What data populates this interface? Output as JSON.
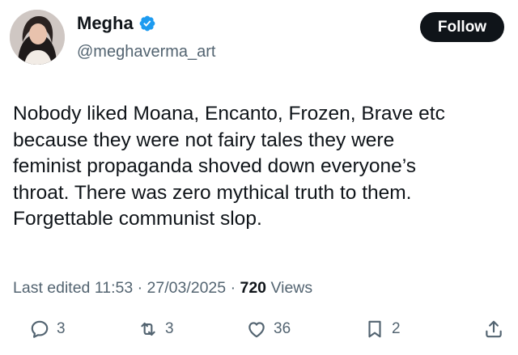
{
  "author": {
    "display_name": "Megha",
    "handle": "@meghaverma_art",
    "verified": true,
    "verified_color": "#1d9bf0",
    "avatar_icon": "profile-photo"
  },
  "follow_button": {
    "label": "Follow"
  },
  "tweet": {
    "lines": [
      "Nobody liked Moana, Encanto, Frozen, Brave etc",
      "because they were not fairy tales they were",
      "feminist propaganda shoved down everyone’s",
      "throat. There was zero mythical truth to them.",
      "Forgettable communist slop."
    ]
  },
  "meta": {
    "edited_label": "Last edited",
    "time": "11:53",
    "separator": "·",
    "date": "27/03/2025",
    "views_count": "720",
    "views_label": "Views"
  },
  "actions": {
    "replies": {
      "icon": "reply-icon",
      "count": "3"
    },
    "reposts": {
      "icon": "repost-icon",
      "count": "3"
    },
    "likes": {
      "icon": "like-icon",
      "count": "36"
    },
    "bookmarks": {
      "icon": "bookmark-icon",
      "count": "2"
    },
    "share": {
      "icon": "share-icon"
    }
  }
}
